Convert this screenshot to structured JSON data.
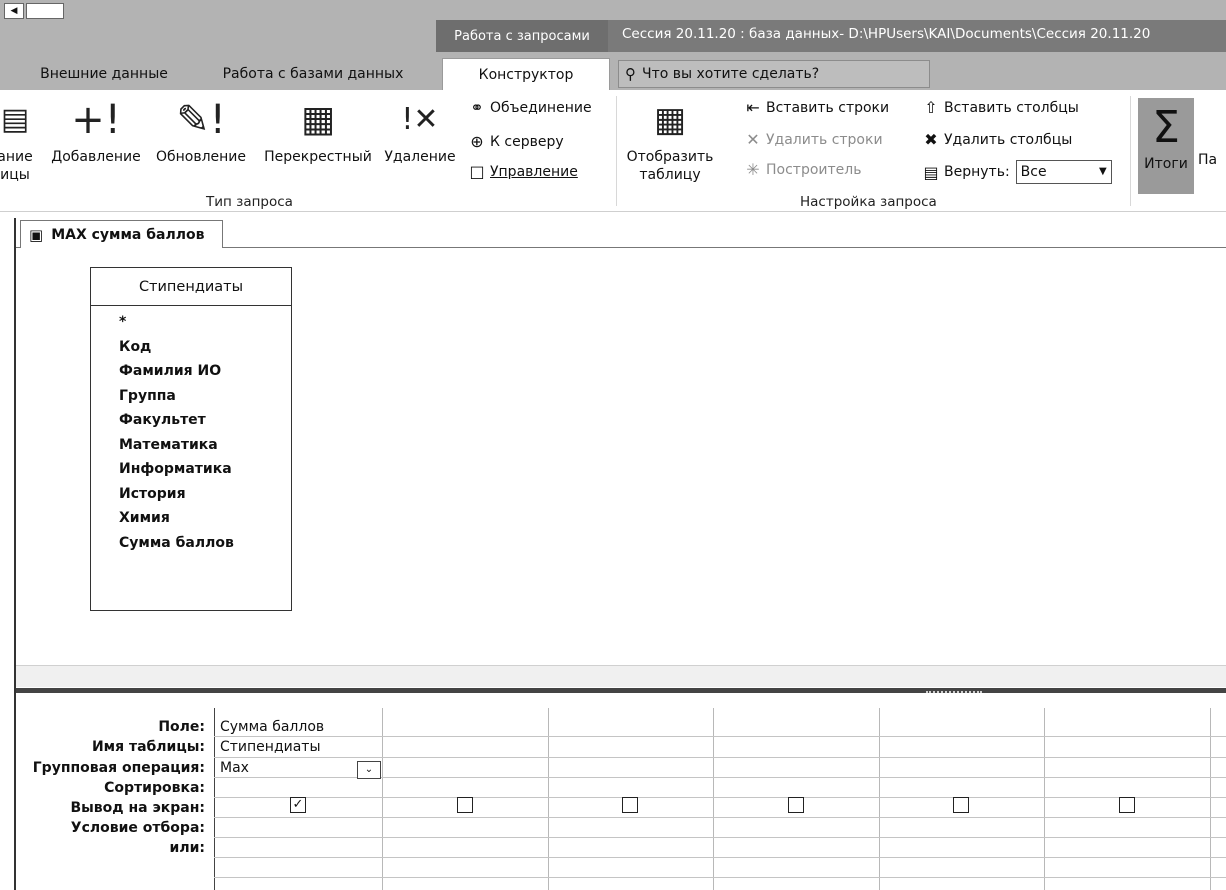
{
  "titlebar": {
    "context_group": "Работа с запросами",
    "window_title": "Сессия 20.11.20 : база данных- D:\\HPUsers\\KAI\\Documents\\Сессия 20.11.20",
    "tabs": {
      "external": "Внешние данные",
      "dbtools": "Работа с базами данных",
      "designer": "Конструктор"
    },
    "tell_me": "Что вы хотите сделать?"
  },
  "ribbon": {
    "query_type": {
      "label": "Тип запроса",
      "make_table_line1": "ание",
      "make_table_line2": "ицы",
      "append": "Добавление",
      "update": "Обновление",
      "crosstab": "Перекрестный",
      "delete": "Удаление",
      "union": "Объединение",
      "passthrough": "К серверу",
      "data_definition": "Управление"
    },
    "query_setup": {
      "label": "Настройка запроса",
      "show_table_line1": "Отобразить",
      "show_table_line2": "таблицу",
      "insert_rows": "Вставить строки",
      "delete_rows": "Удалить строки",
      "builder": "Построитель",
      "insert_columns": "Вставить столбцы",
      "delete_columns": "Удалить столбцы",
      "return_label": "Вернуть:",
      "return_value": "Все"
    },
    "totals": "Итоги",
    "params_partial": "Па"
  },
  "document": {
    "tab_title": "MAX сумма баллов",
    "table": {
      "name": "Стипендиаты",
      "fields": [
        "*",
        "Код",
        "Фамилия ИО",
        "Группа",
        "Факультет",
        "Математика",
        "Информатика",
        "История",
        "Химия",
        "Сумма баллов"
      ]
    },
    "grid": {
      "row_labels": {
        "field": "Поле:",
        "table": "Имя таблицы:",
        "total": "Групповая операция:",
        "sort": "Сортировка:",
        "show": "Вывод на экран:",
        "criteria": "Условие отбора:",
        "or": "или:"
      },
      "columns": [
        {
          "field": "Сумма баллов",
          "table": "Стипендиаты",
          "total": "Max",
          "show": true
        },
        {
          "show": false
        },
        {
          "show": false
        },
        {
          "show": false
        },
        {
          "show": false
        },
        {
          "show": false
        }
      ]
    }
  }
}
